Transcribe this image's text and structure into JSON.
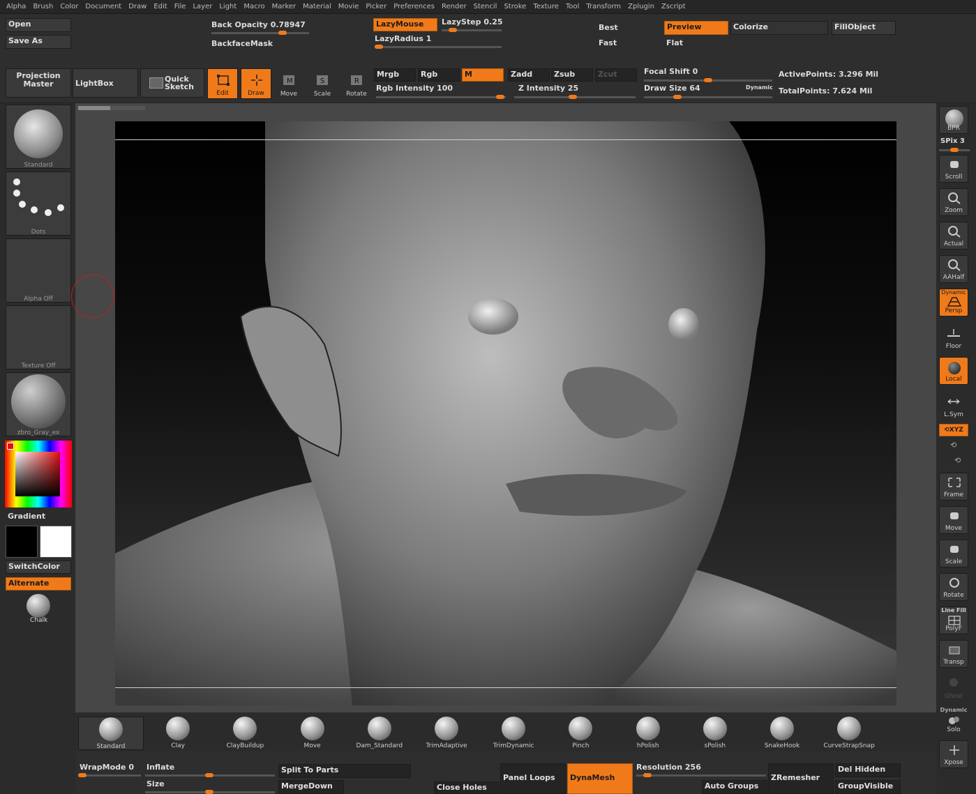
{
  "menu": [
    "Alpha",
    "Brush",
    "Color",
    "Document",
    "Draw",
    "Edit",
    "File",
    "Layer",
    "Light",
    "Macro",
    "Marker",
    "Material",
    "Movie",
    "Picker",
    "Preferences",
    "Render",
    "Stencil",
    "Stroke",
    "Texture",
    "Tool",
    "Transform",
    "Zplugin",
    "Zscript"
  ],
  "top": {
    "open": "Open",
    "save_as": "Save As",
    "back_opacity_label": "Back Opacity",
    "back_opacity_value": "0.78947",
    "back_opacity_level": 0.72,
    "backface_mask": "BackfaceMask",
    "lazy_mouse": "LazyMouse",
    "lazy_step_label": "LazyStep",
    "lazy_step_value": "0.25",
    "lazy_step_level": 0.2,
    "lazy_radius_label": "LazyRadius",
    "lazy_radius_value": "1",
    "lazy_radius_level": 0.02,
    "best": "Best",
    "fast": "Fast",
    "preview": "Preview",
    "flat": "Flat",
    "colorize": "Colorize",
    "fill_object": "FillObject"
  },
  "toolbar": {
    "projection_master_1": "Projection",
    "projection_master_2": "Master",
    "lightbox": "LightBox",
    "quick_sketch_1": "Quick",
    "quick_sketch_2": "Sketch",
    "edit": "Edit",
    "draw": "Draw",
    "move": "Move",
    "scale": "Scale",
    "rotate": "Rotate",
    "mrgb": "Mrgb",
    "rgb": "Rgb",
    "m": "M",
    "zadd": "Zadd",
    "zsub": "Zsub",
    "zcut": "Zcut",
    "rgb_intensity_label": "Rgb Intensity",
    "rgb_intensity_value": "100",
    "rgb_intensity_level": 1.0,
    "z_intensity_label": "Z Intensity",
    "z_intensity_value": "25",
    "z_intensity_level": 0.25,
    "focal_shift_label": "Focal Shift",
    "focal_shift_value": "0",
    "focal_shift_level": 0.5,
    "draw_size_label": "Draw Size",
    "draw_size_value": "64",
    "draw_size_level": 0.25,
    "dynamic": "Dynamic",
    "active_points_label": "ActivePoints:",
    "active_points_value": "3.296 Mil",
    "total_points_label": "TotalPoints:",
    "total_points_value": "7.624 Mil"
  },
  "left": {
    "brush": "Standard",
    "stroke": "Dots",
    "alpha": "Alpha Off",
    "texture": "Texture Off",
    "material": "zbro_Gray_ex",
    "gradient": "Gradient",
    "switch_color": "SwitchColor",
    "alternate": "Alternate",
    "chalk": "Chalk"
  },
  "right": {
    "bpr": "BPR",
    "spix_label": "SPix",
    "spix_value": "3",
    "scroll": "Scroll",
    "zoom": "Zoom",
    "actual": "Actual",
    "aahalf": "AAHalf",
    "dynamic": "Dynamic",
    "persp": "Persp",
    "floor": "Floor",
    "local": "Local",
    "lsym": "L.Sym",
    "xyz": "XYZ",
    "frame": "Frame",
    "move": "Move",
    "scale": "Scale",
    "rotate": "Rotate",
    "line_fill": "Line Fill",
    "polyf": "PolyF",
    "transp": "Transp",
    "ghost": "Ghost",
    "dynamic2": "Dynamic",
    "solo": "Solo",
    "xpose": "Xpose"
  },
  "brushes": [
    "Standard",
    "Clay",
    "ClayBuildup",
    "Move",
    "Dam_Standard",
    "TrimAdaptive",
    "TrimDynamic",
    "Pinch",
    "hPolish",
    "sPolish",
    "SnakeHook",
    "CurveStrapSnap"
  ],
  "bottom": {
    "wrapmode_label": "WrapMode",
    "wrapmode_value": "0",
    "inflate": "Inflate",
    "size": "Size",
    "split_to_parts": "Split To Parts",
    "merge_down": "MergeDown",
    "close_holes": "Close Holes",
    "panel_loops": "Panel Loops",
    "dynamesh": "DynaMesh",
    "resolution_label": "Resolution",
    "resolution_value": "256",
    "auto_groups": "Auto Groups",
    "zremesher": "ZRemesher",
    "del_hidden": "Del Hidden",
    "group_visible": "GroupVisible"
  },
  "colors": {
    "accent": "#f07a1a",
    "panel": "#2e2e2e",
    "button": "#3a3a3a"
  }
}
